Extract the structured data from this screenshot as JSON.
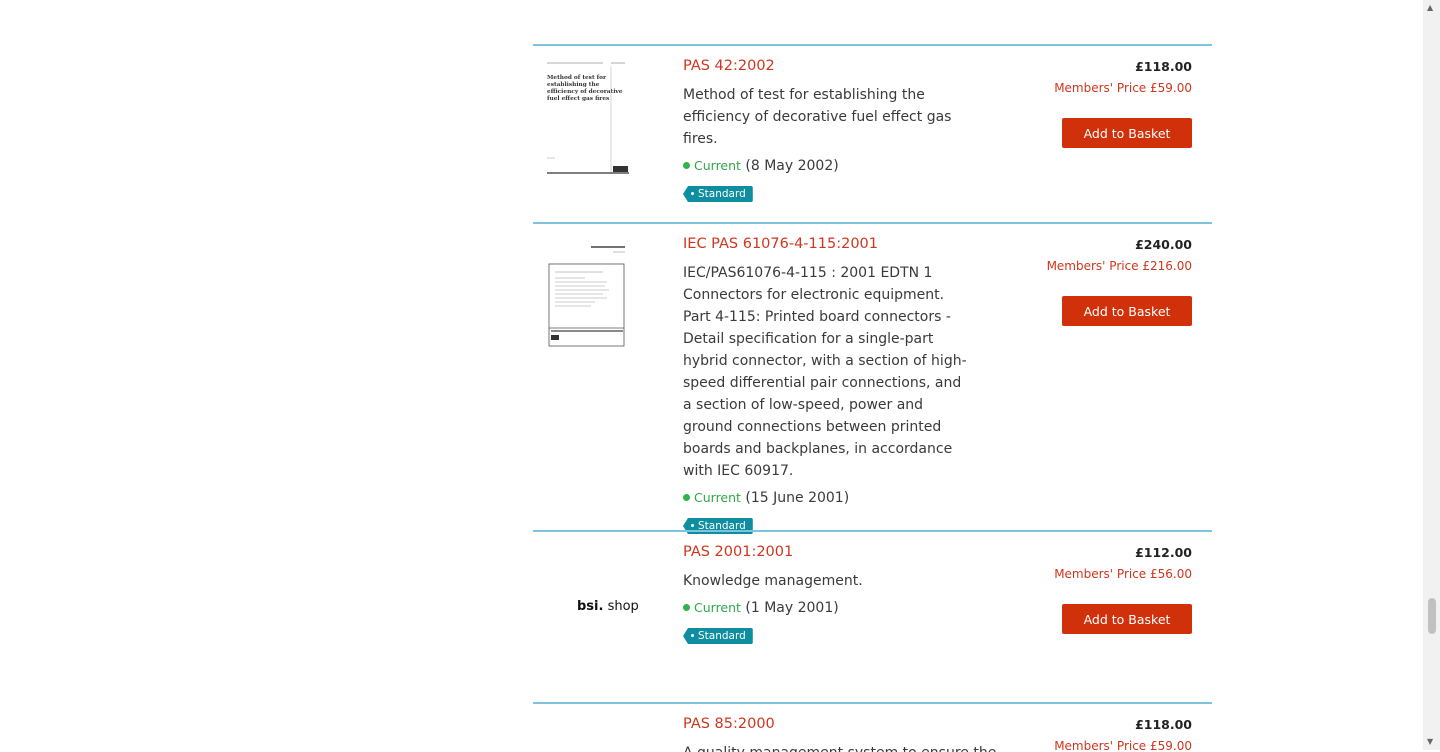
{
  "products": [
    {
      "title": "PAS 42:2002",
      "description": "Method of test for establishing the efficiency of decorative fuel effect gas fires.",
      "status_label": "Current",
      "status_date": "(8 May 2002)",
      "badge": "Standard",
      "price": "£118.00",
      "members_price": "Members' Price £59.00",
      "button": "Add to Basket",
      "thumb_text": "Method of test for establishing the efficiency of decorative fuel effect gas fires"
    },
    {
      "title": "IEC PAS 61076-4-115:2001",
      "description": "IEC/PAS61076-4-115 : 2001 EDTN 1 Connectors for electronic equipment. Part 4-115: Printed board connectors - Detail specification for a single-part hybrid connector, with a section of high-speed differential pair connections, and a section of low-speed, power and ground connections between printed boards and backplanes, in accordance with IEC 60917.",
      "status_label": "Current",
      "status_date": "(15 June 2001)",
      "badge": "Standard",
      "price": "£240.00",
      "members_price": "Members' Price £216.00",
      "button": "Add to Basket"
    },
    {
      "title": "PAS 2001:2001",
      "description": "Knowledge management.",
      "status_label": "Current",
      "status_date": "(1 May 2001)",
      "badge": "Standard",
      "price": "£112.00",
      "members_price": "Members' Price £56.00",
      "button": "Add to Basket",
      "logo_bold": "bsi.",
      "logo_text": " shop"
    },
    {
      "title": "PAS 85:2000",
      "description": "A quality management system to ensure the",
      "price": "£118.00",
      "members_price": "Members' Price £59.00"
    }
  ],
  "colors": {
    "accent": "#d0361d",
    "button": "#d0310a",
    "badge": "#0f8ea1",
    "divider": "#7ec4dc",
    "current": "#2fa84a"
  }
}
